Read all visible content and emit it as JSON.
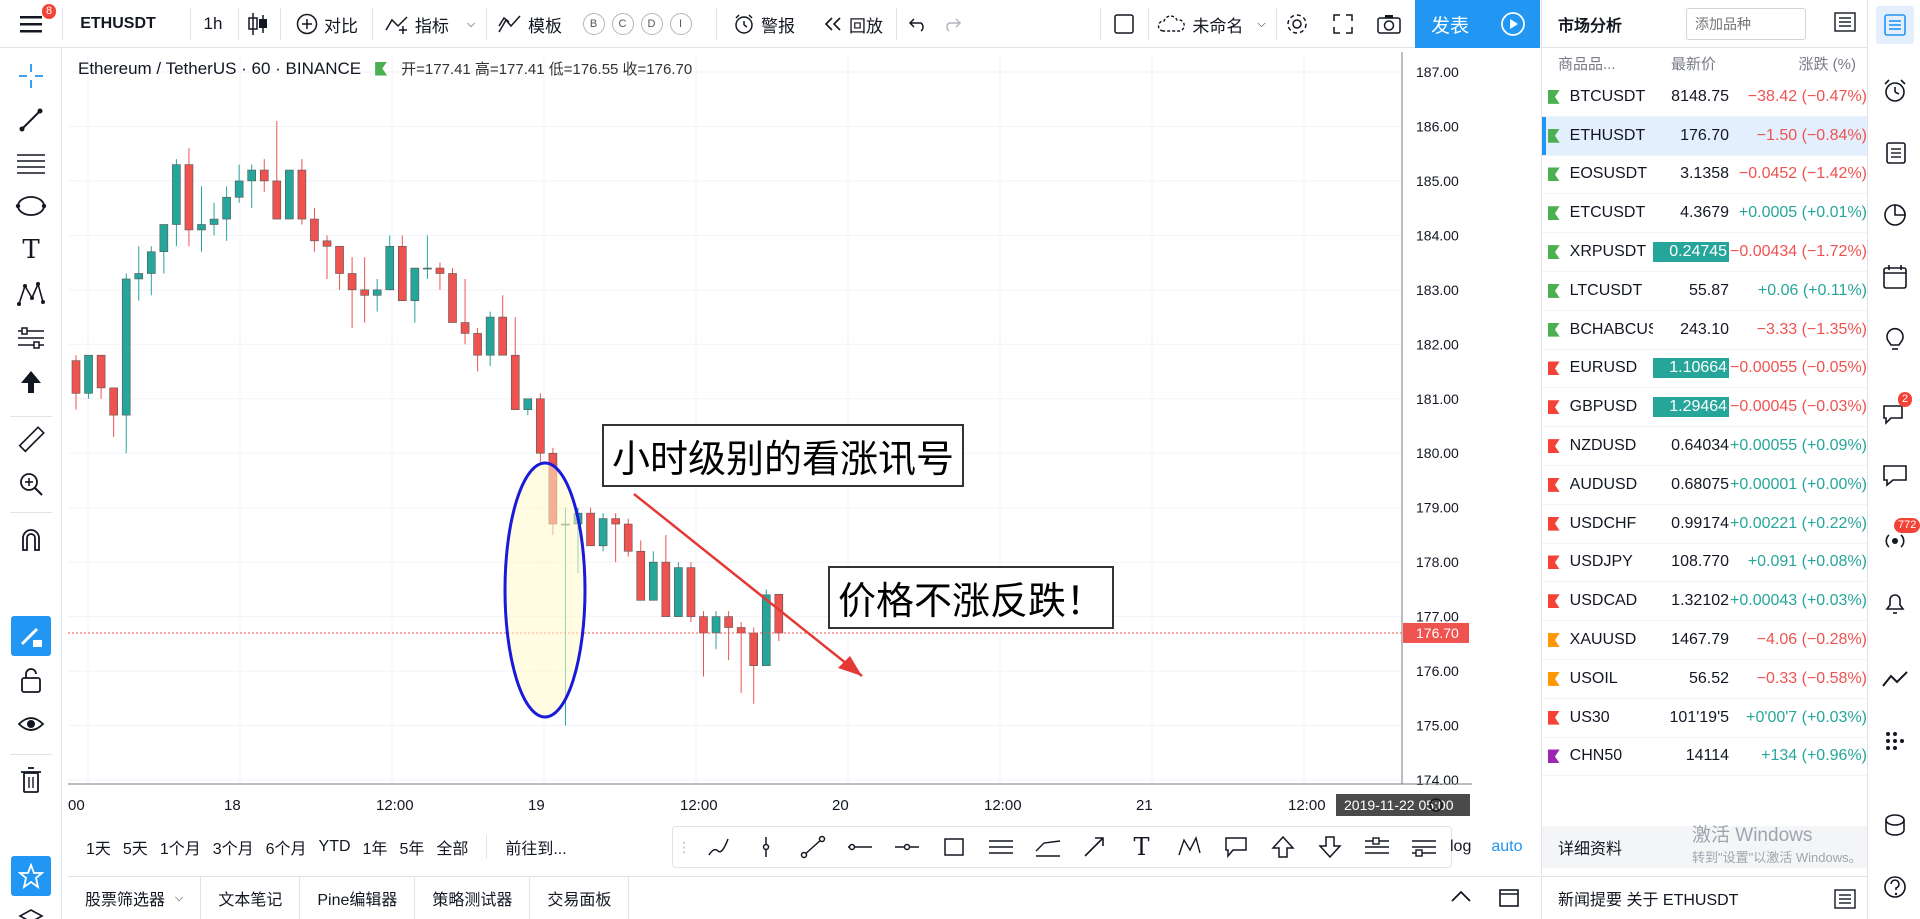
{
  "topbar": {
    "symbol": "ETHUSDT",
    "interval": "1h",
    "compare": "对比",
    "indicators": "指标",
    "templates": "模板",
    "circle_buttons": [
      "B",
      "C",
      "D",
      "I"
    ],
    "alert": "警报",
    "replay": "回放",
    "layout_name": "未命名",
    "publish": "发表",
    "notification_count": "8"
  },
  "legend": {
    "title": "Ethereum / TetherUS · 60 · BINANCE",
    "ohlc": "开=177.41 高=177.41 低=176.55 收=176.70"
  },
  "chart_data": {
    "type": "candlestick",
    "price_axis": [
      "187.00",
      "186.00",
      "185.00",
      "184.00",
      "183.00",
      "182.00",
      "181.00",
      "180.00",
      "179.00",
      "178.00",
      "177.00",
      "176.00",
      "175.00",
      "174.00"
    ],
    "ylim": [
      174,
      187
    ],
    "time_axis": [
      "00",
      "18",
      "12:00",
      "19",
      "12:00",
      "20",
      "12:00",
      "21",
      "12:00"
    ],
    "current_price": "176.70",
    "crosshair_time": "2019-11-22  05:00",
    "up_color": "#26a69a",
    "down_color": "#ef5350",
    "candles": [
      [
        181.7,
        181.8,
        180.8,
        181.1
      ],
      [
        181.1,
        181.8,
        181.0,
        181.8
      ],
      [
        181.8,
        181.8,
        181.0,
        181.2
      ],
      [
        181.2,
        181.2,
        180.3,
        180.7
      ],
      [
        180.7,
        183.3,
        180.0,
        183.2
      ],
      [
        183.2,
        183.8,
        182.8,
        183.3
      ],
      [
        183.3,
        183.8,
        182.9,
        183.7
      ],
      [
        183.7,
        184.0,
        183.3,
        184.2
      ],
      [
        184.2,
        185.4,
        183.8,
        185.3
      ],
      [
        185.3,
        185.6,
        183.8,
        184.1
      ],
      [
        184.1,
        184.9,
        183.7,
        184.2
      ],
      [
        184.2,
        184.6,
        184.0,
        184.3
      ],
      [
        184.3,
        184.9,
        183.9,
        184.7
      ],
      [
        184.7,
        185.3,
        184.6,
        185.0
      ],
      [
        185.0,
        185.3,
        184.5,
        185.2
      ],
      [
        185.2,
        185.4,
        184.8,
        185.0
      ],
      [
        185.0,
        186.1,
        184.3,
        184.3
      ],
      [
        184.3,
        185.0,
        184.3,
        185.2
      ],
      [
        185.2,
        185.4,
        184.2,
        184.3
      ],
      [
        184.3,
        184.5,
        183.7,
        183.9
      ],
      [
        183.9,
        184.0,
        183.2,
        183.8
      ],
      [
        183.8,
        183.8,
        183.0,
        183.3
      ],
      [
        183.3,
        183.6,
        182.3,
        183.0
      ],
      [
        183.0,
        183.6,
        182.4,
        182.9
      ],
      [
        182.9,
        183.2,
        182.6,
        183.0
      ],
      [
        183.0,
        184.0,
        183.0,
        183.8
      ],
      [
        183.8,
        184.0,
        182.9,
        182.8
      ],
      [
        182.8,
        183.4,
        182.4,
        183.4
      ],
      [
        183.4,
        184.0,
        183.2,
        183.4
      ],
      [
        183.4,
        183.5,
        183.0,
        183.3
      ],
      [
        183.3,
        183.4,
        182.4,
        182.4
      ],
      [
        182.4,
        183.2,
        182.0,
        182.2
      ],
      [
        182.2,
        182.3,
        181.5,
        181.8
      ],
      [
        181.8,
        182.6,
        181.6,
        182.5
      ],
      [
        182.5,
        182.9,
        181.8,
        181.8
      ],
      [
        181.8,
        182.5,
        181.0,
        180.8
      ],
      [
        180.8,
        181.0,
        180.7,
        181.0
      ],
      [
        181.0,
        181.1,
        179.8,
        180.0
      ],
      [
        180.0,
        180.1,
        178.5,
        178.7
      ],
      [
        178.7,
        179.0,
        175.0,
        178.7
      ],
      [
        178.7,
        179.0,
        177.8,
        178.9
      ],
      [
        178.9,
        179.0,
        178.4,
        178.3
      ],
      [
        178.3,
        178.9,
        178.2,
        178.8
      ],
      [
        178.8,
        178.9,
        178.0,
        178.7
      ],
      [
        178.7,
        178.8,
        178.1,
        178.2
      ],
      [
        178.2,
        178.4,
        177.5,
        177.3
      ],
      [
        177.3,
        178.2,
        177.3,
        178.0
      ],
      [
        178.0,
        178.5,
        177.1,
        177.0
      ],
      [
        177.0,
        178.0,
        177.0,
        177.9
      ],
      [
        177.9,
        178.0,
        176.9,
        177.0
      ],
      [
        177.0,
        177.1,
        175.9,
        176.7
      ],
      [
        176.7,
        177.1,
        176.4,
        177.0
      ],
      [
        177.0,
        177.1,
        176.2,
        176.8
      ],
      [
        176.8,
        176.9,
        175.6,
        176.7
      ],
      [
        176.7,
        176.8,
        175.4,
        176.1
      ],
      [
        176.1,
        177.5,
        176.1,
        177.4
      ],
      [
        177.41,
        177.41,
        176.55,
        176.7
      ]
    ]
  },
  "annotations": {
    "note1": "小时级别的看涨讯号",
    "note2": "价格不涨反跌！"
  },
  "ranges": [
    "1天",
    "5天",
    "1个月",
    "3个月",
    "6个月",
    "YTD",
    "1年",
    "5年",
    "全部"
  ],
  "goto": "前往到...",
  "log": "log",
  "auto": "auto",
  "bottom_tabs": [
    "股票筛选器",
    "文本笔记",
    "Pine编辑器",
    "策略测试器",
    "交易面板"
  ],
  "watchlist": {
    "title": "市场分析",
    "add_placeholder": "添加品种",
    "col_symbol": "商品品...",
    "col_last": "最新价",
    "col_change": "涨跌 (%)",
    "rows": [
      {
        "sym": "BTCUSDT",
        "last": "8148.75",
        "chg": "−38.42 (−0.47%)",
        "dir": "dn",
        "flag": "#4caf50"
      },
      {
        "sym": "ETHUSDT",
        "last": "176.70",
        "chg": "−1.50 (−0.84%)",
        "dir": "dn",
        "flag": "#4caf50",
        "active": true
      },
      {
        "sym": "EOSUSDT",
        "last": "3.1358",
        "chg": "−0.0452 (−1.42%)",
        "dir": "dn",
        "flag": "#4caf50"
      },
      {
        "sym": "ETCUSDT",
        "last": "4.3679",
        "chg": "+0.0005 (+0.01%)",
        "dir": "up",
        "flag": "#4caf50"
      },
      {
        "sym": "XRPUSDT",
        "last": "0.24745",
        "chg": "−0.00434 (−1.72%)",
        "dir": "dn",
        "flag": "#4caf50",
        "hl": true
      },
      {
        "sym": "LTCUSDT",
        "last": "55.87",
        "chg": "+0.06 (+0.11%)",
        "dir": "up",
        "flag": "#4caf50"
      },
      {
        "sym": "BCHABCUSDT",
        "last": "243.10",
        "chg": "−3.33 (−1.35%)",
        "dir": "dn",
        "flag": "#4caf50"
      },
      {
        "sym": "EURUSD",
        "last": "1.10664",
        "chg": "−0.00055 (−0.05%)",
        "dir": "dn",
        "flag": "#f44336",
        "hl": true
      },
      {
        "sym": "GBPUSD",
        "last": "1.29464",
        "chg": "−0.00045 (−0.03%)",
        "dir": "dn",
        "flag": "#f44336",
        "hl": true
      },
      {
        "sym": "NZDUSD",
        "last": "0.64034",
        "chg": "+0.00055 (+0.09%)",
        "dir": "up",
        "flag": "#f44336"
      },
      {
        "sym": "AUDUSD",
        "last": "0.68075",
        "chg": "+0.00001 (+0.00%)",
        "dir": "up",
        "flag": "#f44336"
      },
      {
        "sym": "USDCHF",
        "last": "0.99174",
        "chg": "+0.00221 (+0.22%)",
        "dir": "up",
        "flag": "#f44336"
      },
      {
        "sym": "USDJPY",
        "last": "108.770",
        "chg": "+0.091 (+0.08%)",
        "dir": "up",
        "flag": "#f44336"
      },
      {
        "sym": "USDCAD",
        "last": "1.32102",
        "chg": "+0.00043 (+0.03%)",
        "dir": "up",
        "flag": "#f44336"
      },
      {
        "sym": "XAUUSD",
        "last": "1467.79",
        "chg": "−4.06 (−0.28%)",
        "dir": "dn",
        "flag": "#ff9800"
      },
      {
        "sym": "USOIL",
        "last": "56.52",
        "chg": "−0.33 (−0.58%)",
        "dir": "dn",
        "flag": "#ff9800"
      },
      {
        "sym": "US30",
        "last": "101'19'5",
        "chg": "+0'00'7 (+0.03%)",
        "dir": "up",
        "flag": "#f44336"
      },
      {
        "sym": "CHN50",
        "last": "14114",
        "chg": "+134 (+0.96%)",
        "dir": "up",
        "flag": "#9c27b0"
      }
    ],
    "detail": "详细资料",
    "news": "新闻提要 关于 ETHUSDT"
  },
  "watermark": {
    "line1": "激活 Windows",
    "line2": "转到\"设置\"以激活 Windows。"
  },
  "right_badges": {
    "chat": "2",
    "streams": "772"
  },
  "colors": {
    "accent": "#2196f3",
    "up": "#26a69a",
    "down": "#ef5350",
    "annotation": "#1a1adb",
    "arrow": "#e53935"
  }
}
